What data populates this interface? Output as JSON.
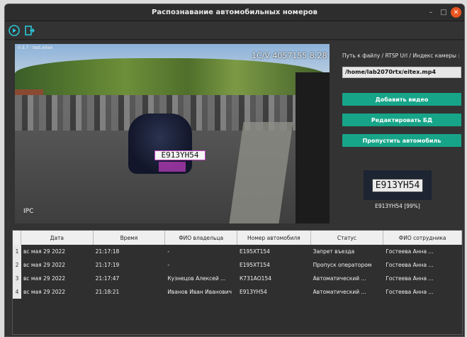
{
  "window": {
    "title": "Распознавание автомобильных номеров",
    "controls": [
      "–",
      "□",
      "✕"
    ]
  },
  "toolbar": {
    "icons": [
      "play-icon",
      "exit-icon"
    ]
  },
  "video": {
    "overlay_top_left": "0.3.7 · test.eitex",
    "overlay_top_right": "1С/V 4057155 8:28",
    "overlay_bottom_left": "IPC",
    "detected_plate": "E913YH54"
  },
  "side": {
    "path_label": "Путь к файлу / RTSP Url / Индекс камеры :",
    "path_value": "/home/lab2070rtx/eitex.mp4",
    "add_video": "Добавить видео",
    "edit_db": "Редактировать БД",
    "skip_car": "Пропустить автомобиль",
    "plate_image_text": "E913YH54",
    "plate_caption": "E913YH54 [99%]"
  },
  "table": {
    "headers": [
      "Дата",
      "Время",
      "ФИО владельца",
      "Номер автомобиля",
      "Статус",
      "ФИО сотрудника"
    ],
    "rows": [
      {
        "n": "1",
        "date": "вс мая 29 2022",
        "time": "21:17:18",
        "owner": "-",
        "plate": "E195XT154",
        "status": "Запрет въезда",
        "employee": "Гостеева Анна ..."
      },
      {
        "n": "2",
        "date": "вс мая 29 2022",
        "time": "21:17:19",
        "owner": "-",
        "plate": "E195XT154",
        "status": "Пропуск оператором",
        "employee": "Гостеева Анна ..."
      },
      {
        "n": "3",
        "date": "вс мая 29 2022",
        "time": "21:17:47",
        "owner": "Кузнецов Алексей ...",
        "plate": "К731АО154",
        "status": "Автоматический ...",
        "employee": "Гостеева Анна ..."
      },
      {
        "n": "4",
        "date": "вс мая 29 2022",
        "time": "21:18:21",
        "owner": "Иванов Иван Иванович",
        "plate": "E913YH54",
        "status": "Автоматический ...",
        "employee": "Гостеева Анна ..."
      }
    ]
  },
  "colors": {
    "accent": "#17a589",
    "close": "#e95420",
    "plate_box": "#c43fc6"
  }
}
